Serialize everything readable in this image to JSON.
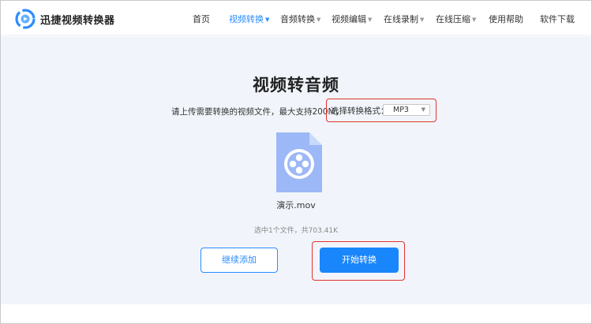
{
  "header": {
    "brand": "迅捷视频转换器",
    "nav": [
      {
        "label": "首页",
        "dropdown": false,
        "active": false
      },
      {
        "label": "视频转换",
        "dropdown": true,
        "active": true
      },
      {
        "label": "音频转换",
        "dropdown": true,
        "active": false
      },
      {
        "label": "视频编辑",
        "dropdown": true,
        "active": false
      },
      {
        "label": "在线录制",
        "dropdown": true,
        "active": false
      },
      {
        "label": "在线压缩",
        "dropdown": true,
        "active": false
      },
      {
        "label": "使用帮助",
        "dropdown": false,
        "active": false
      },
      {
        "label": "软件下载",
        "dropdown": false,
        "active": false
      }
    ]
  },
  "main": {
    "title": "视频转音频",
    "upload_info": "请上传需要转换的视频文件，最大支持200M，",
    "format_label": "选择转换格式：",
    "format_value": "MP3",
    "file_name": "演示.mov",
    "file_count": "选中1个文件，共703.41K",
    "add_button": "继续添加",
    "start_button": "开始转换"
  },
  "colors": {
    "accent": "#2a8cff",
    "primary_button": "#1a86fb",
    "highlight": "#e2322d",
    "main_bg": "#f1f5fb",
    "file_icon": "#9db8f6"
  },
  "icons": {
    "logo": "app-logo-icon",
    "file": "video-file-icon",
    "dropdown": "caret-down-icon"
  }
}
